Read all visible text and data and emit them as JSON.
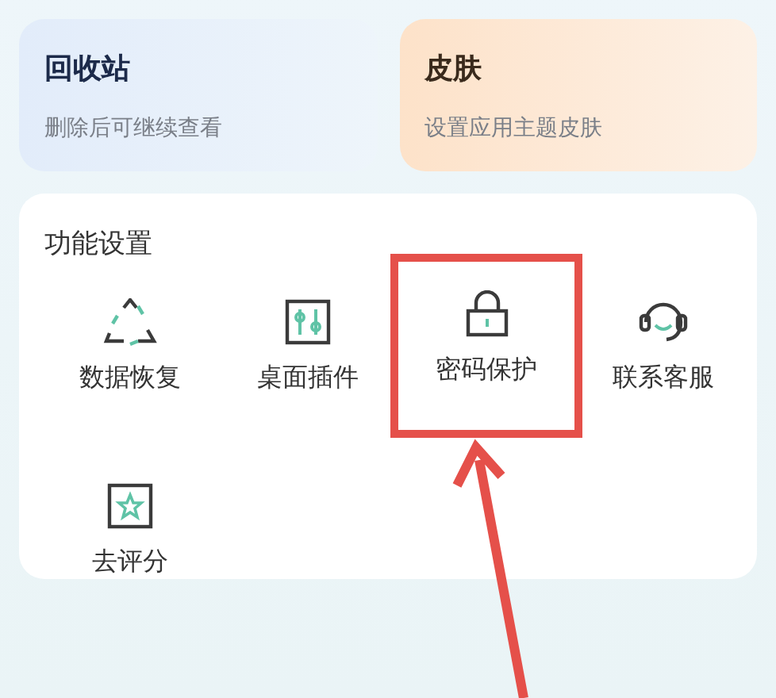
{
  "top_cards": [
    {
      "kind": "blue",
      "title": "回收站",
      "subtitle": "删除后可继续查看"
    },
    {
      "kind": "orange",
      "title": "皮肤",
      "subtitle": "设置应用主题皮肤"
    }
  ],
  "settings": {
    "title": "功能设置",
    "items": [
      {
        "kind": "recycle",
        "label": "数据恢复",
        "highlighted": false
      },
      {
        "kind": "sliders",
        "label": "桌面插件",
        "highlighted": false
      },
      {
        "kind": "lock",
        "label": "密码保护",
        "highlighted": true
      },
      {
        "kind": "headset",
        "label": "联系客服",
        "highlighted": false
      },
      {
        "kind": "star",
        "label": "去评分",
        "highlighted": false
      }
    ]
  }
}
